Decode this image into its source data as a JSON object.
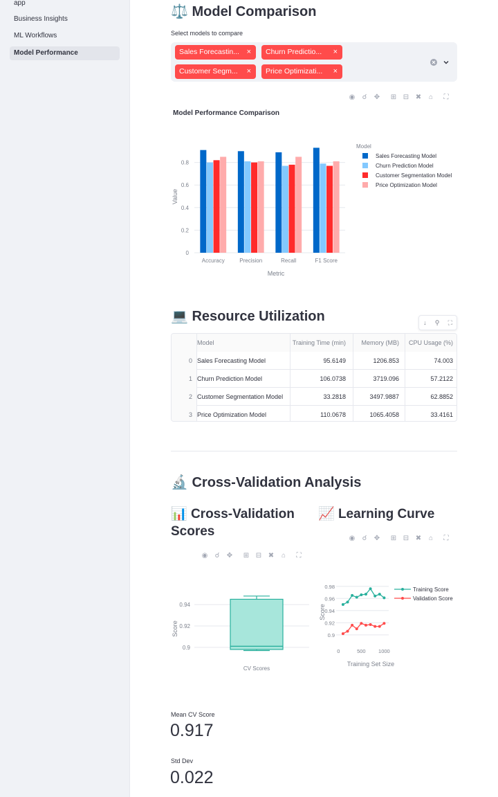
{
  "sidebar": {
    "items": [
      {
        "label": "app",
        "active": false
      },
      {
        "label": "Business Insights",
        "active": false
      },
      {
        "label": "ML Workflows",
        "active": false
      },
      {
        "label": "Model Performance",
        "active": true
      }
    ]
  },
  "model_comparison": {
    "emoji": "⚖️",
    "title": "Model Comparison",
    "select_label": "Select models to compare",
    "selected": [
      {
        "label": "Sales Forecastin..."
      },
      {
        "label": "Churn Predictio..."
      },
      {
        "label": "Customer Segm..."
      },
      {
        "label": "Price Optimizati..."
      }
    ],
    "remove_glyph": "×"
  },
  "toolbar_icons": [
    "camera-icon",
    "zoom-icon",
    "pan-icon",
    "zoom-in-icon",
    "zoom-out-icon",
    "autoscale-icon",
    "home-icon",
    "fullscreen-icon"
  ],
  "resource": {
    "emoji": "💻",
    "title": "Resource Utilization",
    "columns": [
      "Model",
      "Training Time (min)",
      "Memory (MB)",
      "CPU Usage (%)"
    ],
    "rows": [
      {
        "idx": "0",
        "model": "Sales Forecasting Model",
        "train": "95.6149",
        "mem": "1206.853",
        "cpu": "74.003"
      },
      {
        "idx": "1",
        "model": "Churn Prediction Model",
        "train": "106.0738",
        "mem": "3719.096",
        "cpu": "57.2122"
      },
      {
        "idx": "2",
        "model": "Customer Segmentation Model",
        "train": "33.2818",
        "mem": "3497.9887",
        "cpu": "62.8852"
      },
      {
        "idx": "3",
        "model": "Price Optimization Model",
        "train": "110.0678",
        "mem": "1065.4058",
        "cpu": "33.4161"
      }
    ]
  },
  "cross_validation": {
    "emoji": "🔬",
    "title": "Cross-Validation Analysis",
    "scores_emoji": "📊",
    "scores_title_line1": "Cross-Validation",
    "scores_title_line2": "Scores",
    "curve_emoji": "📈",
    "curve_title": "Learning Curve",
    "mean_label": "Mean CV Score",
    "mean_value": "0.917",
    "std_label": "Std Dev",
    "std_value": "0.022"
  },
  "colors": {
    "sales": "#0068c9",
    "churn": "#83c9ff",
    "segmentation": "#ff2b2b",
    "price": "#ffabab",
    "box": "#7defa1",
    "training": "#29b09d",
    "validation": "#ff4b4b"
  },
  "chart_data": [
    {
      "type": "bar",
      "title": "Model Performance Comparison",
      "xlabel": "Metric",
      "ylabel": "Value",
      "categories": [
        "Accuracy",
        "Precision",
        "Recall",
        "F1 Score"
      ],
      "ylim": [
        0,
        1.0
      ],
      "yticks": [
        "0",
        "0.2",
        "0.4",
        "0.6",
        "0.8"
      ],
      "legend_title": "Model",
      "legend_position": "right",
      "series": [
        {
          "name": "Sales Forecasting Model",
          "color": "#0068c9",
          "values": [
            0.91,
            0.9,
            0.89,
            0.93
          ]
        },
        {
          "name": "Churn Prediction Model",
          "color": "#83c9ff",
          "values": [
            0.8,
            0.81,
            0.77,
            0.79
          ]
        },
        {
          "name": "Customer Segmentation Model",
          "color": "#ff2b2b",
          "values": [
            0.82,
            0.8,
            0.78,
            0.77
          ]
        },
        {
          "name": "Price Optimization Model",
          "color": "#ffabab",
          "values": [
            0.85,
            0.81,
            0.85,
            0.81
          ]
        }
      ]
    },
    {
      "type": "box",
      "xlabel": "",
      "ylabel": "Score",
      "category": "CV Scores",
      "yticks": [
        "0.9",
        "0.92",
        "0.94"
      ],
      "ylim": [
        0.885,
        0.955
      ],
      "min": 0.897,
      "q1": 0.898,
      "median": 0.901,
      "q3": 0.945,
      "max": 0.948
    },
    {
      "type": "line",
      "xlabel": "Training Set Size",
      "ylabel": "Score",
      "xlim": [
        -50,
        1100
      ],
      "ylim": [
        0.885,
        0.99
      ],
      "xticks": [
        "0",
        "500",
        "1000"
      ],
      "yticks": [
        "0.9",
        "0.92",
        "0.94",
        "0.96",
        "0.98"
      ],
      "legend_position": "right",
      "series": [
        {
          "name": "Training Score",
          "color": "#29b09d",
          "x": [
            100,
            200,
            300,
            400,
            500,
            600,
            700,
            800,
            900,
            1000
          ],
          "y": [
            0.95,
            0.954,
            0.965,
            0.962,
            0.966,
            0.967,
            0.976,
            0.964,
            0.967,
            0.961
          ]
        },
        {
          "name": "Validation Score",
          "color": "#ff4b4b",
          "x": [
            100,
            200,
            300,
            400,
            500,
            600,
            700,
            800,
            900,
            1000
          ],
          "y": [
            0.902,
            0.906,
            0.916,
            0.91,
            0.919,
            0.916,
            0.917,
            0.914,
            0.914,
            0.919
          ]
        }
      ]
    }
  ]
}
